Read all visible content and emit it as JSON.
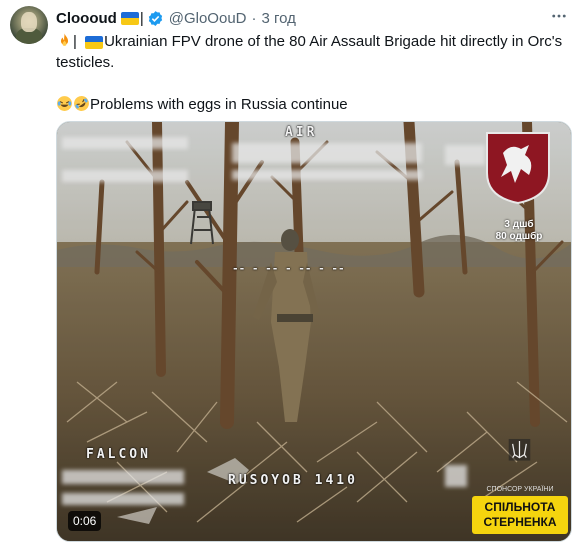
{
  "tweet": {
    "author_name": "Cloooud",
    "name_separator": "|",
    "handle": "@GloOouD",
    "dot": "·",
    "time": "3 год",
    "text_line1": "Ukrainian FPV drone of the 80 Air Assault Brigade hit directly in Orc's",
    "text_line2": "testicles.",
    "text_line3": "Problems with eggs in Russia continue",
    "line1_prefix_sep": "|"
  },
  "media": {
    "duration": "0:06",
    "osd_top": "AIR",
    "osd_left": "FALCON",
    "osd_bottom": "RUSOYOB 1410",
    "badge_line1": "3 дшб",
    "badge_line2": "80 одшбр",
    "sp_small": "СПОНСОР УКРАЇНИ",
    "sp_line1": "СПІЛЬНОТА",
    "sp_line2": "СТЕРНЕНКА"
  },
  "icons": {
    "verified": "verified-badge-icon",
    "more": "more-options-icon",
    "fire": "fire-emoji-icon",
    "laugh": "rolling-laughing-emoji-icon",
    "flag": "ukraine-flag-icon"
  },
  "colors": {
    "text": "#0f1419",
    "secondary": "#536471",
    "verified": "#1d9bf0",
    "flag_blue": "#1d6cd6",
    "flag_yellow": "#f7c815"
  }
}
